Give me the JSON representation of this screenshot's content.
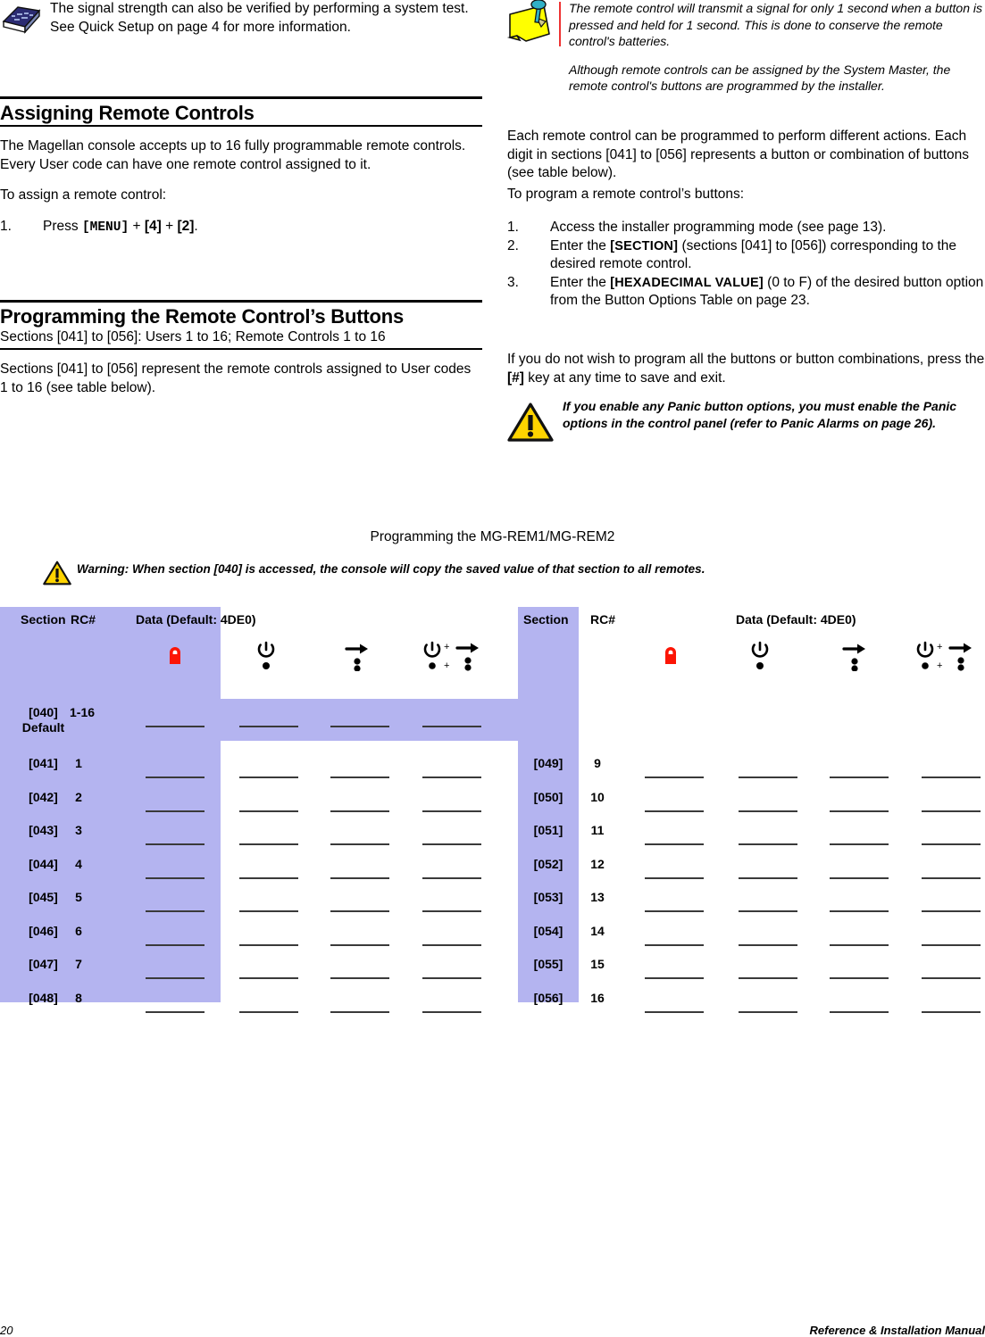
{
  "left_column": {
    "book_note": {
      "icon": "book-icon",
      "text": "The signal strength can also be verified by performing a system test. See Quick Setup on page 4 for more information."
    },
    "section1": {
      "heading": "Assigning Remote Controls",
      "para1": "The Magellan console accepts up to 16 fully programmable remote controls. Every User code can have one remote control assigned to it.",
      "para2": "To assign a remote control:",
      "step1_num": "1.",
      "step1_pre": "Press ",
      "step1_key1": "[MENU]",
      "step1_plus1": " + ",
      "step1_key2": "[4]",
      "step1_plus2": " + ",
      "step1_key3": "[2]",
      "step1_post": "."
    },
    "section2": {
      "heading": "Programming the Remote Control’s Buttons",
      "subheading": "Sections [041] to [056]: Users 1 to 16; Remote Controls 1 to 16",
      "para1": "Sections [041] to [056] represent the remote controls assigned to User codes 1 to 16 (see table below)."
    }
  },
  "right_column": {
    "note": {
      "icon": "sticky-note-icon",
      "para1": "The remote control will transmit a signal for only 1 second when a button is pressed and held for 1 second. This is done to conserve the remote control's batteries.",
      "para2": "Although remote controls can be assigned by the System Master, the remote control's buttons are programmed by the installer."
    },
    "para1": "Each remote control can be programmed to perform different actions. Each digit in sections [041] to [056] represents a button or combination of buttons (see table below).",
    "para2": "To program a remote control’s buttons:",
    "steps": [
      {
        "num": "1.",
        "pre": "Access the installer programming mode (see page 13).",
        "key": "",
        "post": ""
      },
      {
        "num": "2.",
        "pre": "Enter the ",
        "key": "[SECTION]",
        "post": " (sections [041] to [056]) corresponding to the desired remote control."
      },
      {
        "num": "3.",
        "pre": "Enter the ",
        "key": "[HEXADECIMAL VALUE]",
        "post": " (0 to F) of the desired button option from the Button Options Table on page 23."
      }
    ],
    "para3_pre": "If you do not wish to program all the buttons or button combinations, press the ",
    "para3_key": "[#]",
    "para3_post": " key at any time to save and exit.",
    "warning": {
      "icon": "warning-triangle-icon",
      "text": "If you enable any Panic button options, you must enable the Panic options in the control panel (refer to Panic Alarms on page 26)."
    }
  },
  "table_section": {
    "caption": "Programming the MG-REM1/MG-REM2",
    "warning": {
      "icon": "warning-triangle-icon",
      "text": "Warning: When section [040] is accessed, the console will copy the saved value of that section to all remotes."
    },
    "headers": {
      "section": "Section",
      "rc": "RC#",
      "data": "Data (Default: 4DE0)"
    },
    "button_icons": [
      "lock-icon",
      "power-plus-one-dot-icon",
      "arrow-plus-two-dots-icon",
      "power-dot-plus-arrow-dots-icon"
    ],
    "default_row": {
      "section": "[040]",
      "section_sub": "Default",
      "rc": "1-16",
      "blanks": 4
    },
    "left_rows": [
      {
        "section": "[041]",
        "rc": "1"
      },
      {
        "section": "[042]",
        "rc": "2"
      },
      {
        "section": "[043]",
        "rc": "3"
      },
      {
        "section": "[044]",
        "rc": "4"
      },
      {
        "section": "[045]",
        "rc": "5"
      },
      {
        "section": "[046]",
        "rc": "6"
      },
      {
        "section": "[047]",
        "rc": "7"
      },
      {
        "section": "[048]",
        "rc": "8"
      }
    ],
    "right_rows": [
      {
        "section": "[049]",
        "rc": "9"
      },
      {
        "section": "[050]",
        "rc": "10"
      },
      {
        "section": "[051]",
        "rc": "11"
      },
      {
        "section": "[052]",
        "rc": "12"
      },
      {
        "section": "[053]",
        "rc": "13"
      },
      {
        "section": "[054]",
        "rc": "14"
      },
      {
        "section": "[055]",
        "rc": "15"
      },
      {
        "section": "[056]",
        "rc": "16"
      }
    ],
    "colors": {
      "band": "#b4b4f0",
      "lock": "#fc1505",
      "warning_fill": "#ffd400",
      "note_fill": "#ffff00",
      "pin": "#31b0c6"
    }
  },
  "footer": {
    "page_number": "20",
    "manual_title": "Reference & Installation Manual"
  }
}
